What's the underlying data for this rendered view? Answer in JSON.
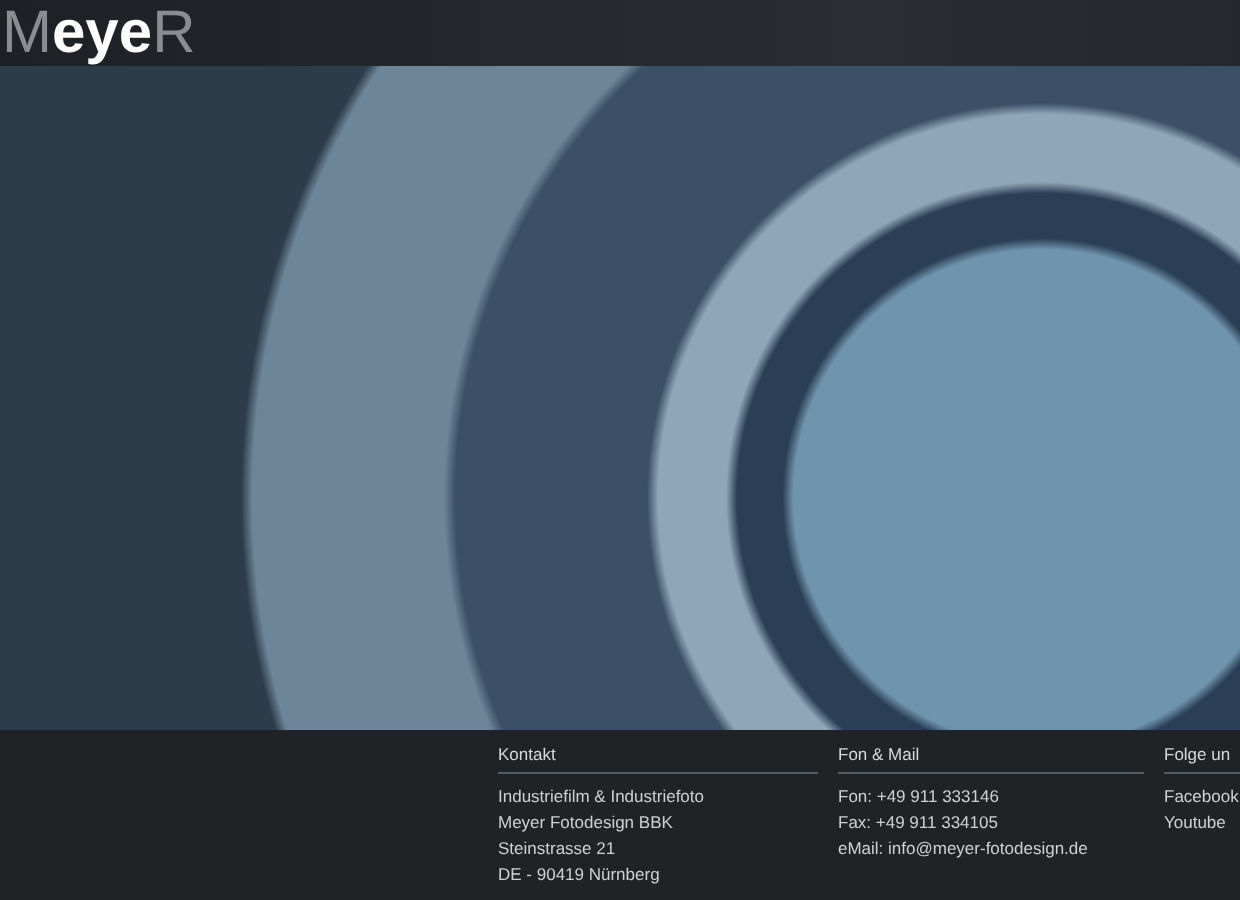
{
  "header": {
    "logo": "M**eye**R"
  },
  "footer": {
    "columns": [
      {
        "heading": "Kontakt",
        "lines": [
          "Industriefilm & Industriefoto",
          "Meyer Fotodesign BBK",
          "Steinstrasse 21",
          "DE - 90419 Nürnberg"
        ]
      },
      {
        "heading": "Fon & Mail",
        "lines": [
          "Fon: +49 911 333146",
          "Fax: +49 911 334105",
          "eMail: info@meyer-fotodesign.de"
        ]
      },
      {
        "heading": "Folge un",
        "lines": [
          "Facebook",
          "Youtube"
        ]
      }
    ]
  }
}
